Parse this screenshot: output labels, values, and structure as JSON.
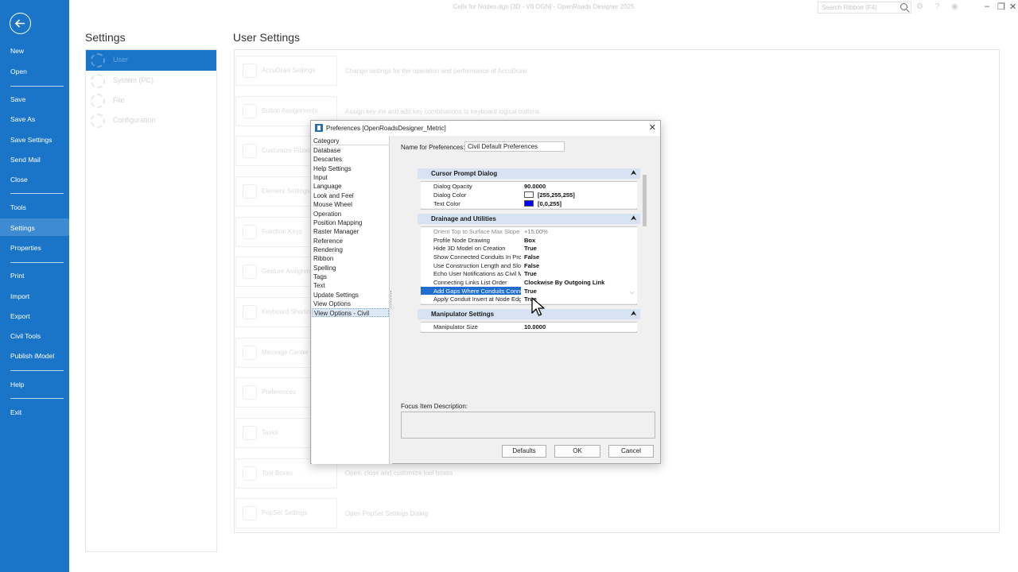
{
  "app": {
    "window_title": "Cells for Nodes.dgn [3D - V8 DGN] - OpenRoads Designer 2025",
    "search_placeholder": "Search Ribbon (F4)",
    "title_icons": "⚙ ? ◉",
    "window_controls": {
      "minimize": "–",
      "restore": "❐",
      "close": "✕"
    }
  },
  "backstage": {
    "items": [
      {
        "label": "New"
      },
      {
        "label": "Open"
      },
      {
        "label": "Save"
      },
      {
        "label": "Save As"
      },
      {
        "label": "Save Settings"
      },
      {
        "label": "Send Mail"
      },
      {
        "label": "Close"
      },
      {
        "label": "Tools"
      },
      {
        "label": "Settings"
      },
      {
        "label": "Properties"
      },
      {
        "label": "Print"
      },
      {
        "label": "Import"
      },
      {
        "label": "Export"
      },
      {
        "label": "Civil Tools"
      },
      {
        "label": "Publish iModel"
      },
      {
        "label": "Help"
      },
      {
        "label": "Exit"
      }
    ],
    "active": "Settings"
  },
  "settings": {
    "title": "Settings",
    "categories": [
      {
        "label": "User",
        "selected": true
      },
      {
        "label": "System (PC)"
      },
      {
        "label": "File"
      },
      {
        "label": "Configuration"
      }
    ]
  },
  "user_settings": {
    "title": "User Settings",
    "tiles": [
      {
        "label": "AccuDraw Settings",
        "desc": "Change settings for the operation and performance of AccuDraw"
      },
      {
        "label": "Button Assignments",
        "desc": "Assign key-ins and add key combinations to keyboard logical buttons"
      },
      {
        "label": "Customize Ribbon",
        "desc": ""
      },
      {
        "label": "Element Settings",
        "desc": ""
      },
      {
        "label": "Function Keys",
        "desc": ""
      },
      {
        "label": "Gesture Assignments",
        "desc": ""
      },
      {
        "label": "Keyboard Shortcuts",
        "desc": ""
      },
      {
        "label": "Message Center",
        "desc": ""
      },
      {
        "label": "Preferences",
        "desc": ""
      },
      {
        "label": "Tasks",
        "desc": ""
      },
      {
        "label": "Tool Boxes",
        "desc": "Open, close and customize tool boxes"
      },
      {
        "label": "PopSet Settings",
        "desc": "Open PopSet Settings Dialog"
      }
    ]
  },
  "dialog": {
    "title": "Preferences [OpenRoadsDesigner_Metric]",
    "close": "✕",
    "category_header": "Category",
    "categories": [
      "Database",
      "Descartes",
      "Help Settings",
      "Input",
      "Language",
      "Look and Feel",
      "Mouse Wheel",
      "Operation",
      "Position Mapping",
      "Raster Manager",
      "Reference",
      "Rendering",
      "Ribbon",
      "Spelling",
      "Tags",
      "Text",
      "Update Settings",
      "View Options",
      "View Options - Civil"
    ],
    "selected_category": "View Options - Civil",
    "name_label": "Name for Preferences:",
    "name_value": "Civil Default Preferences",
    "sections": {
      "cursor_prompt": {
        "title": "Cursor Prompt Dialog",
        "rows": [
          {
            "name": "Dialog Opacity",
            "value": "90.0000"
          },
          {
            "name": "Dialog Color",
            "value": "[255,255,255]",
            "color": "#ffffff"
          },
          {
            "name": "Text Color",
            "value": "[0,0,255]",
            "color": "#0000ff"
          }
        ]
      },
      "drainage": {
        "title": "Drainage and Utilities",
        "rows": [
          {
            "name": "Orient Top to Surface Max Slope",
            "value": "+15.00%"
          },
          {
            "name": "Profile Node Drawing",
            "value": "Box"
          },
          {
            "name": "Hide 3D Model on Creation",
            "value": "True"
          },
          {
            "name": "Show Connected Conduits In Profile",
            "value": "False"
          },
          {
            "name": "Use Construction Length and Slope",
            "value": "False"
          },
          {
            "name": "Echo User Notifications as Civil Messages",
            "value": "True"
          },
          {
            "name": "Connecting Links List Order",
            "value": "Clockwise By Outgoing Link"
          },
          {
            "name": "Add Gaps Where Conduits Connect",
            "value": "True"
          },
          {
            "name": "Apply Conduit Invert at Node Edge",
            "value": "True"
          }
        ]
      },
      "manipulator": {
        "title": "Manipulator Settings",
        "rows": [
          {
            "name": "Manipulator Size",
            "value": "10.0000"
          }
        ]
      }
    },
    "focus_label": "Focus Item Description:",
    "focus_text": "",
    "buttons": {
      "defaults": "Defaults",
      "ok": "OK",
      "cancel": "Cancel"
    }
  },
  "colors": {
    "backstage_blue": "#1a75c8",
    "section_header": "#d7e3f3",
    "row_selected": "#1f6fd1"
  }
}
